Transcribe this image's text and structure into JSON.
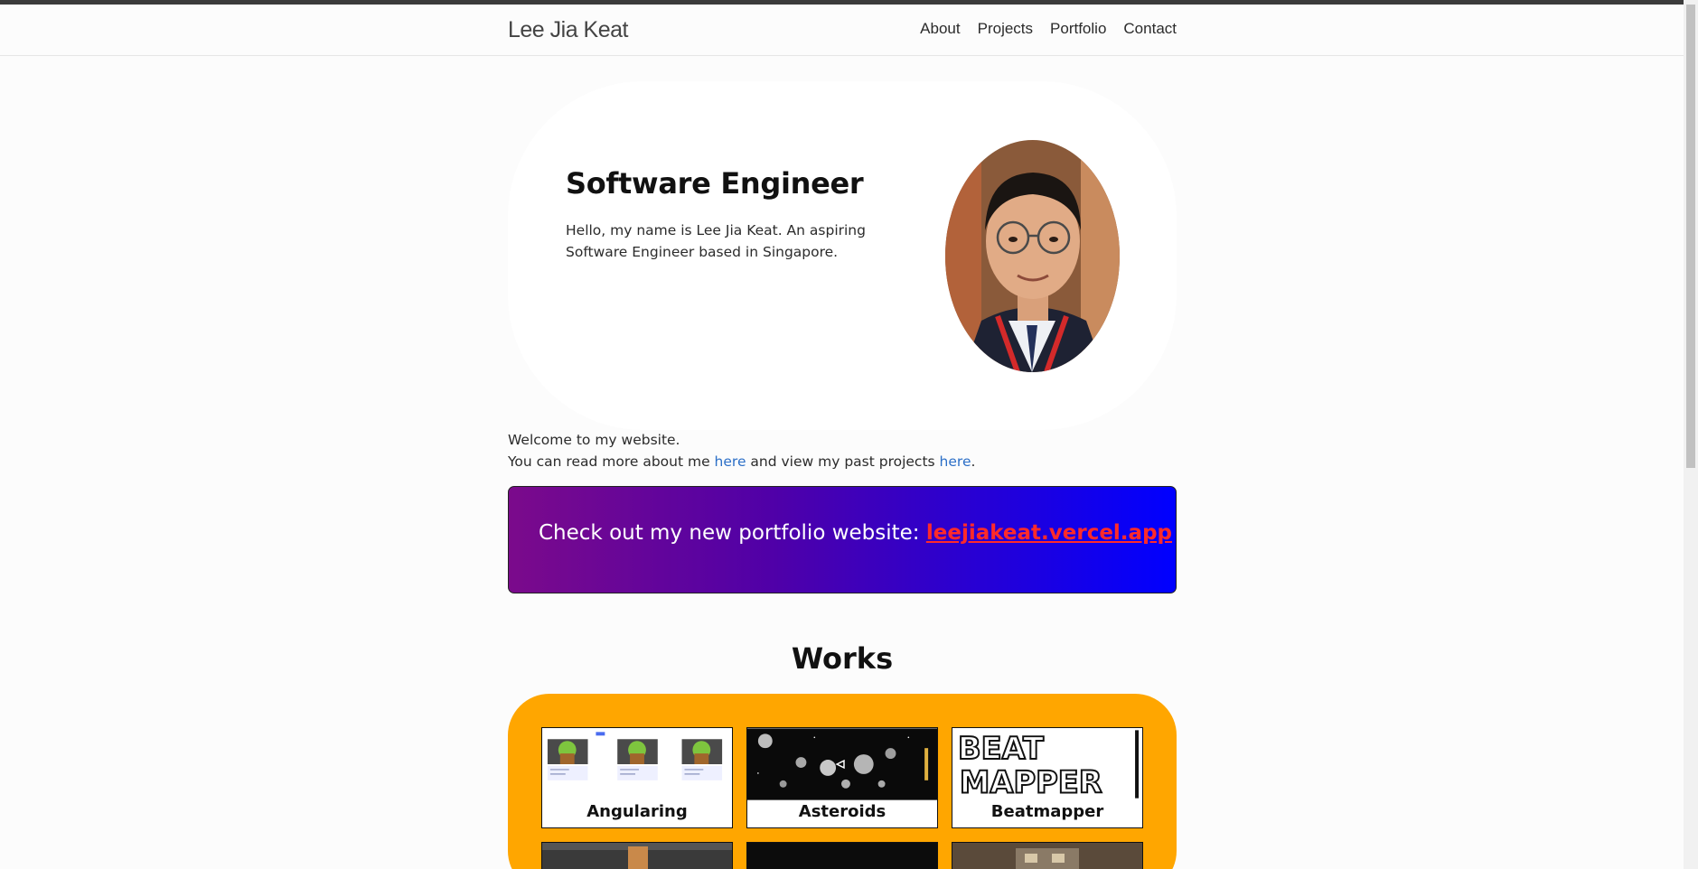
{
  "navbar": {
    "brand": "Lee Jia Keat",
    "links": [
      "About",
      "Projects",
      "Portfolio",
      "Contact"
    ]
  },
  "hero": {
    "title": "Software Engineer",
    "description": "Hello, my name is Lee Jia Keat. An aspiring Software Engineer based in Singapore."
  },
  "welcome": {
    "line1": "Welcome to my website.",
    "line2_part1": "You can read more about me ",
    "link1": "here",
    "line2_part2": " and view my past projects ",
    "link2": "here",
    "line2_end": "."
  },
  "banner": {
    "text": "Check out my new portfolio website: ",
    "link": "leejiakeat.vercel.app"
  },
  "works": {
    "title": "Works",
    "cards": [
      "Angularing",
      "Asteroids",
      "Beatmapper"
    ]
  },
  "beatmapper_logo": [
    "BEAT",
    "MAPPER"
  ],
  "colors": {
    "accent_orange": "#ffa600",
    "link_blue": "#2c6fc7",
    "banner_link_red": "#ff2a2a"
  }
}
